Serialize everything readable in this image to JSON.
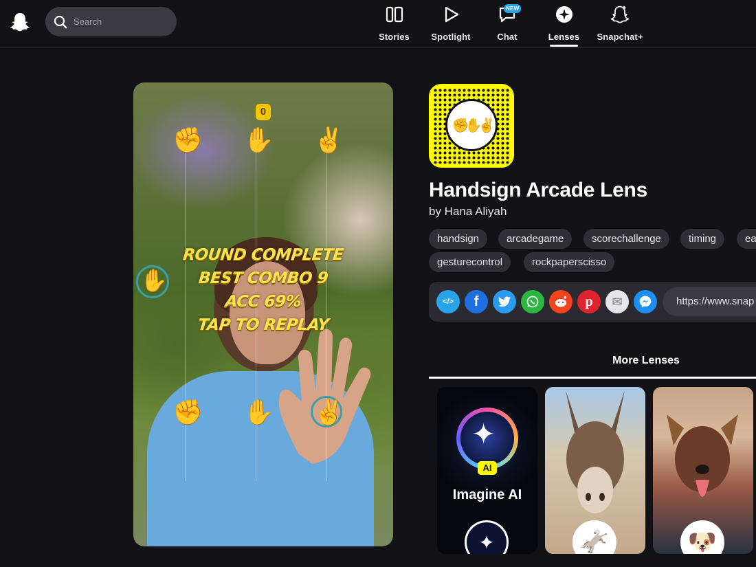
{
  "nav": {
    "search_placeholder": "Search",
    "items": [
      {
        "label": "Stories",
        "icon": "stories-icon"
      },
      {
        "label": "Spotlight",
        "icon": "play-icon"
      },
      {
        "label": "Chat",
        "icon": "chat-icon",
        "badge": "NEW"
      },
      {
        "label": "Lenses",
        "icon": "lens-sparkle-icon",
        "active": true
      },
      {
        "label": "Snapchat+",
        "icon": "ghost-plus-icon"
      }
    ]
  },
  "preview": {
    "score": "0",
    "overlay_lines": [
      "ROUND COMPLETE",
      "BEST COMBO 9",
      "ACC 69%",
      "TAP TO REPLAY"
    ],
    "top_signs": [
      "✊",
      "✋",
      "✌️"
    ],
    "bottom_signs": [
      "✊",
      "✋",
      "✌️"
    ],
    "side_sign": "✋"
  },
  "lens": {
    "title": "Handsign Arcade Lens",
    "author": "by Hana Aliyah",
    "snapcode_emoji": "✊✋✌️",
    "tags": [
      "handsign",
      "arcadegame",
      "scorechallenge",
      "timing",
      "ea",
      "gesturecontrol",
      "rockpaperscisso"
    ]
  },
  "share": {
    "buttons": [
      {
        "name": "embed-icon",
        "color": "#2aa4e8",
        "glyph": "</>"
      },
      {
        "name": "facebook-icon",
        "color": "#1f6fe0",
        "glyph": "f"
      },
      {
        "name": "twitter-icon",
        "color": "#2a9cf0",
        "glyph": "t"
      },
      {
        "name": "whatsapp-icon",
        "color": "#2bb741",
        "glyph": "w"
      },
      {
        "name": "reddit-icon",
        "color": "#f5431d",
        "glyph": "r"
      },
      {
        "name": "pinterest-icon",
        "color": "#e0242f",
        "glyph": "p"
      },
      {
        "name": "email-icon",
        "color": "#e6e6ea",
        "glyph": "✉"
      },
      {
        "name": "messenger-icon",
        "color": "#1d8ef2",
        "glyph": "m"
      }
    ],
    "url": "https://www.snap"
  },
  "more_lenses": {
    "title": "More Lenses",
    "cards": [
      {
        "name": "Imagine AI",
        "pill": "AI"
      },
      {
        "name": "",
        "avatar": "🫏"
      },
      {
        "name": "",
        "avatar": "🐶"
      }
    ]
  },
  "colors": {
    "background": "#121216",
    "snap_yellow": "#fffc00",
    "overlay_yellow": "#ffe24a"
  }
}
